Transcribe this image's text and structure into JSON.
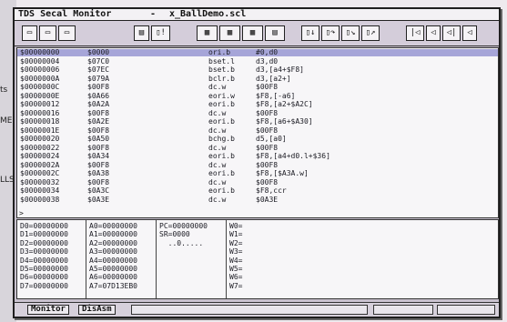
{
  "window": {
    "title_app": "TDS Secal  Monitor",
    "title_sep": "-",
    "title_file": "x_BallDemo.scl"
  },
  "background": {
    "edge_texts": [
      "ts",
      "MEN",
      "LLS"
    ]
  },
  "toolbar": {
    "buttons": [
      {
        "icon": "new-file-icon",
        "label": "▭"
      },
      {
        "icon": "open-file-icon",
        "label": "▭"
      },
      {
        "icon": "save-file-icon",
        "label": "▭"
      },
      {
        "icon": "print-icon",
        "label": "▤"
      },
      {
        "icon": "info-icon",
        "label": "▯!"
      },
      {
        "icon": "memory-grid-icon",
        "label": "▦"
      },
      {
        "icon": "disasm-grid-icon",
        "label": "▦"
      },
      {
        "icon": "register-grid-icon",
        "label": "▦"
      },
      {
        "icon": "list-icon",
        "label": "▤"
      },
      {
        "icon": "step-icon",
        "label": "▯↓"
      },
      {
        "icon": "step-over-icon",
        "label": "▯↷"
      },
      {
        "icon": "trace-icon",
        "label": "▯↘"
      },
      {
        "icon": "run-icon",
        "label": "▯↗"
      },
      {
        "icon": "first-icon",
        "label": "|◁"
      },
      {
        "icon": "back-icon",
        "label": "◁"
      },
      {
        "icon": "prev-icon",
        "label": "◁|"
      },
      {
        "icon": "end-icon",
        "label": "◁"
      }
    ]
  },
  "listing": {
    "rows": [
      {
        "addr": "$00000000",
        "bytes": "$0000",
        "op": "ori.b",
        "args": "#0,d0"
      },
      {
        "addr": "$00000004",
        "bytes": "$07C0",
        "op": "bset.l",
        "args": "d3,d0"
      },
      {
        "addr": "$00000006",
        "bytes": "$07EC",
        "op": "bset.b",
        "args": "d3,[a4+$F8]"
      },
      {
        "addr": "$0000000A",
        "bytes": "$079A",
        "op": "bclr.b",
        "args": "d3,[a2+]"
      },
      {
        "addr": "$0000000C",
        "bytes": "$00F8",
        "op": "dc.w",
        "args": "$00F8"
      },
      {
        "addr": "$0000000E",
        "bytes": "$0A66",
        "op": "eori.w",
        "args": "$F8,[-a6]"
      },
      {
        "addr": "$00000012",
        "bytes": "$0A2A",
        "op": "eori.b",
        "args": "$F8,[a2+$A2C]"
      },
      {
        "addr": "$00000016",
        "bytes": "$00F8",
        "op": "dc.w",
        "args": "$00F8"
      },
      {
        "addr": "$00000018",
        "bytes": "$0A2E",
        "op": "eori.b",
        "args": "$F8,[a6+$A30]"
      },
      {
        "addr": "$0000001E",
        "bytes": "$00F8",
        "op": "dc.w",
        "args": "$00F8"
      },
      {
        "addr": "$00000020",
        "bytes": "$0A50",
        "op": "bchg.b",
        "args": "d5,[a0]"
      },
      {
        "addr": "$00000022",
        "bytes": "$00F8",
        "op": "dc.w",
        "args": "$00F8"
      },
      {
        "addr": "$00000024",
        "bytes": "$0A34",
        "op": "eori.b",
        "args": "$F8,[a4+d0.l+$36]"
      },
      {
        "addr": "$0000002A",
        "bytes": "$00F8",
        "op": "dc.w",
        "args": "$00F8"
      },
      {
        "addr": "$0000002C",
        "bytes": "$0A38",
        "op": "eori.b",
        "args": "$F8,[$A3A.w]"
      },
      {
        "addr": "$00000032",
        "bytes": "$00F8",
        "op": "dc.w",
        "args": "$00F8"
      },
      {
        "addr": "$00000034",
        "bytes": "$0A3C",
        "op": "eori.b",
        "args": "$F8,ccr"
      },
      {
        "addr": "$00000038",
        "bytes": "$0A3E",
        "op": "dc.w",
        "args": "$0A3E"
      }
    ],
    "prompt": ">"
  },
  "registers": {
    "data": [
      "D0=00000000",
      "D1=00000000",
      "D2=00000000",
      "D3=00000000",
      "D4=00000000",
      "D5=00000000",
      "D6=00000000",
      "D7=00000000"
    ],
    "addr": [
      "A0=00000000",
      "A1=00000000",
      "A2=00000000",
      "A3=00000000",
      "A4=00000000",
      "A5=00000000",
      "A6=00000000",
      "A7=07D13EB0"
    ],
    "pc": [
      "PC=00000000",
      "SR=0000",
      "  ..0....."
    ],
    "watch": [
      "W0=",
      "W1=",
      "W2=",
      "W3=",
      "W4=",
      "W5=",
      "W6=",
      "W7="
    ]
  },
  "status": {
    "tabs": [
      "Monitor",
      "DisAsm"
    ]
  }
}
